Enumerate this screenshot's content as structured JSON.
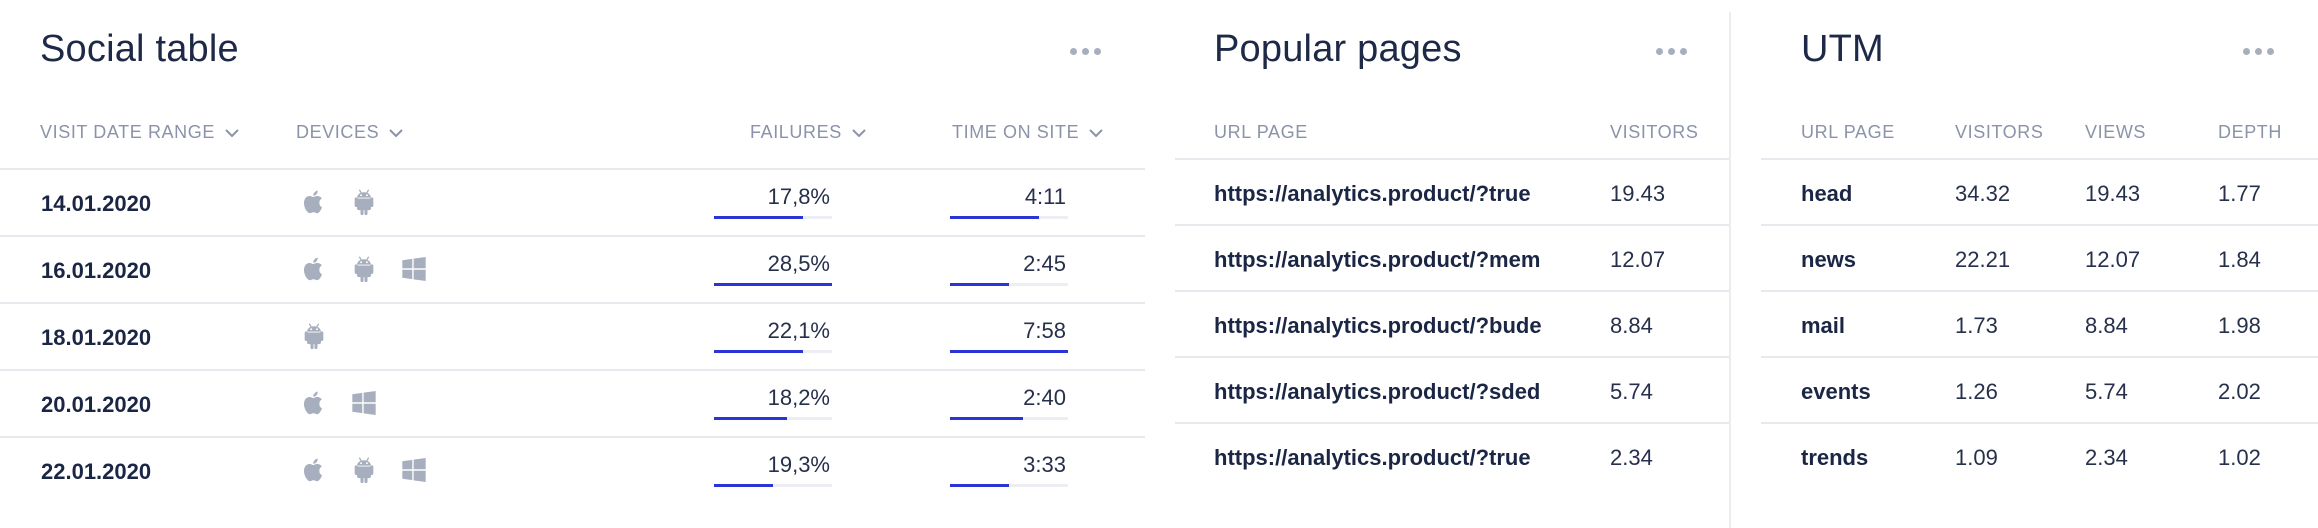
{
  "social": {
    "title": "Social table",
    "headers": {
      "date": "VISIT DATE RANGE",
      "devices": "DEVICES",
      "failures": "FAILURES",
      "time": "TIME ON SITE"
    },
    "rows": [
      {
        "date": "14.01.2020",
        "devices": [
          "apple-icon",
          "android-icon"
        ],
        "failures": "17,8%",
        "failures_level": 0.75,
        "time": "4:11",
        "time_level": 0.75
      },
      {
        "date": "16.01.2020",
        "devices": [
          "apple-icon",
          "android-icon",
          "windows-icon"
        ],
        "failures": "28,5%",
        "failures_level": 1.0,
        "time": "2:45",
        "time_level": 0.5
      },
      {
        "date": "18.01.2020",
        "devices": [
          "android-icon"
        ],
        "failures": "22,1%",
        "failures_level": 0.75,
        "time": "7:58",
        "time_level": 1.0
      },
      {
        "date": "20.01.2020",
        "devices": [
          "apple-icon",
          "windows-icon"
        ],
        "failures": "18,2%",
        "failures_level": 0.62,
        "time": "2:40",
        "time_level": 0.62
      },
      {
        "date": "22.01.2020",
        "devices": [
          "apple-icon",
          "android-icon",
          "windows-icon"
        ],
        "failures": "19,3%",
        "failures_level": 0.5,
        "time": "3:33",
        "time_level": 0.5
      }
    ]
  },
  "popular": {
    "title": "Popular pages",
    "headers": {
      "url": "URL PAGE",
      "visitors": "VISITORS"
    },
    "rows": [
      {
        "url": "https://analytics.product/?true",
        "visitors": "19.43"
      },
      {
        "url": "https://analytics.product/?mem",
        "visitors": "12.07"
      },
      {
        "url": "https://analytics.product/?bude",
        "visitors": "8.84"
      },
      {
        "url": "https://analytics.product/?sded",
        "visitors": "5.74"
      },
      {
        "url": "https://analytics.product/?true",
        "visitors": "2.34"
      }
    ]
  },
  "utm": {
    "title": "UTM",
    "headers": {
      "url": "URL PAGE",
      "visitors": "VISITORS",
      "views": "VIEWS",
      "depth": "DEPTH"
    },
    "rows": [
      {
        "page": "head",
        "visitors": "34.32",
        "views": "19.43",
        "depth": "1.77"
      },
      {
        "page": "news",
        "visitors": "22.21",
        "views": "12.07",
        "depth": "1.84"
      },
      {
        "page": "mail",
        "visitors": "1.73",
        "views": "8.84",
        "depth": "1.98"
      },
      {
        "page": "events",
        "visitors": "1.26",
        "views": "5.74",
        "depth": "2.02"
      },
      {
        "page": "trends",
        "visitors": "1.09",
        "views": "2.34",
        "depth": "1.02"
      }
    ]
  },
  "colors": {
    "accent": "#2b35d6",
    "track": "#eceef3",
    "icon": "#a7aebd",
    "header": "#8a93a8",
    "text": "#1b2645"
  }
}
